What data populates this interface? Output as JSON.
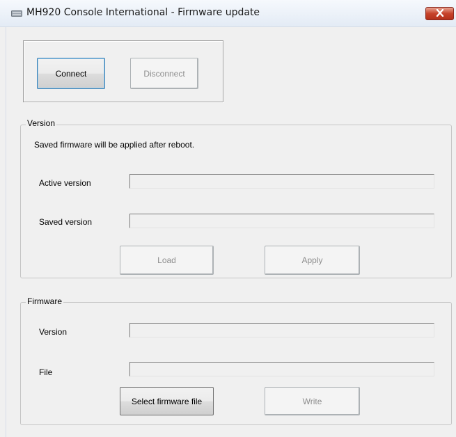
{
  "window": {
    "title": "MH920 Console International - Firmware update"
  },
  "connection": {
    "connect_label": "Connect",
    "disconnect_label": "Disconnect"
  },
  "version_group": {
    "legend": "Version",
    "note": "Saved firmware will be applied after reboot.",
    "active_label": "Active version",
    "active_value": "",
    "saved_label": "Saved version",
    "saved_value": "",
    "load_label": "Load",
    "apply_label": "Apply"
  },
  "firmware_group": {
    "legend": "Firmware",
    "version_label": "Version",
    "version_value": "",
    "file_label": "File",
    "file_value": "",
    "select_label": "Select firmware file",
    "write_label": "Write"
  },
  "icons": {
    "app": "app-icon",
    "close": "close-icon"
  },
  "colors": {
    "close_button": "#c7432b",
    "window_bg": "#f0f0f0"
  }
}
